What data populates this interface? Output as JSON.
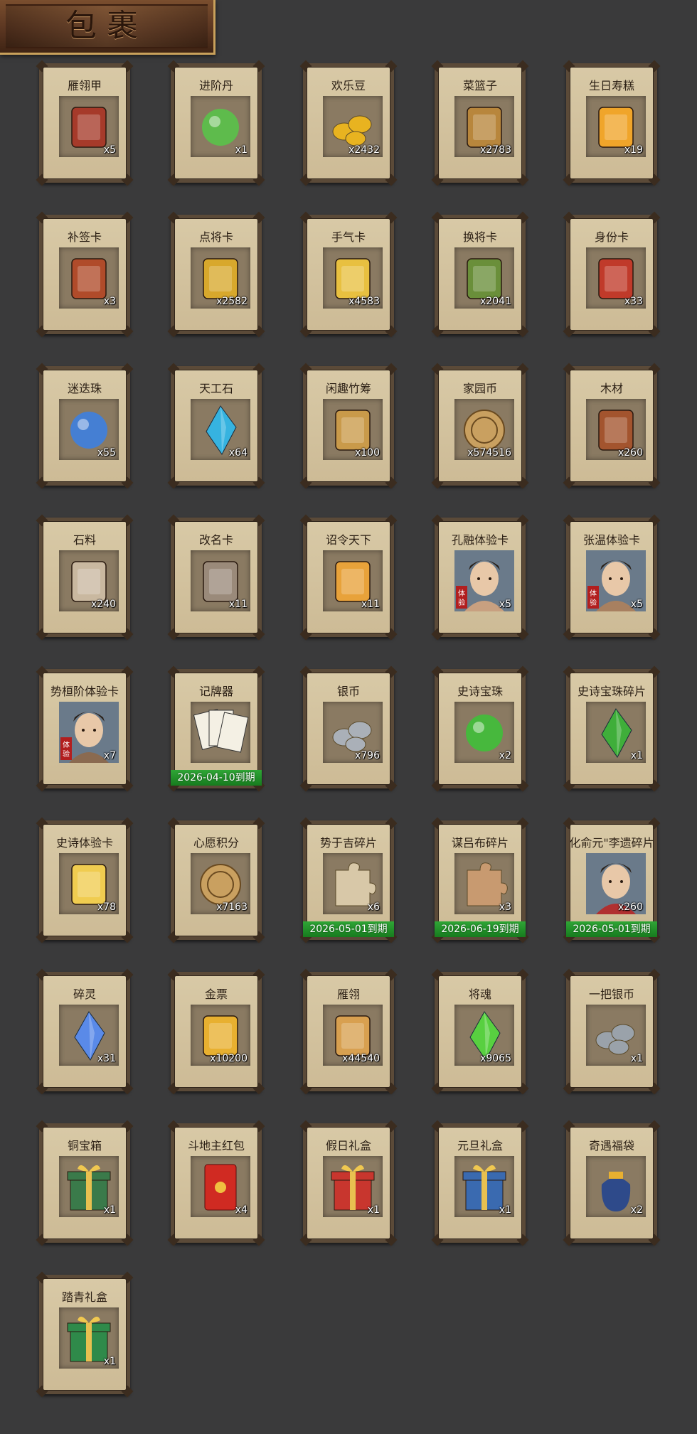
{
  "header": {
    "title": "包裹"
  },
  "colors": {
    "background": "#3a3a3b",
    "card_frame": "#5b4a38",
    "card_paper": "#d8c9a6",
    "expiry_green": "#1f9128"
  },
  "items": [
    {
      "name": "雁翎甲",
      "count": "x5",
      "icon": "armor-icon",
      "color": "#a63a2a"
    },
    {
      "name": "进阶丹",
      "count": "x1",
      "icon": "green-pill-icon",
      "color": "#59c24a"
    },
    {
      "name": "欢乐豆",
      "count": "x2432",
      "icon": "gold-beans-icon",
      "color": "#e8b320"
    },
    {
      "name": "菜篮子",
      "count": "x2783",
      "icon": "basket-icon",
      "color": "#b8863c"
    },
    {
      "name": "生日寿糕",
      "count": "x19",
      "icon": "cake-icon",
      "color": "#f0a52a"
    },
    {
      "name": "补签卡",
      "count": "x3",
      "icon": "token-card-icon",
      "color": "#b04b2a"
    },
    {
      "name": "点将卡",
      "count": "x2582",
      "icon": "general-card-icon",
      "color": "#d8a82c"
    },
    {
      "name": "手气卡",
      "count": "x4583",
      "icon": "luck-card-icon",
      "color": "#e8c040"
    },
    {
      "name": "换将卡",
      "count": "x2041",
      "icon": "swap-card-icon",
      "color": "#6a8f3a"
    },
    {
      "name": "身份卡",
      "count": "x33",
      "icon": "mask-card-icon",
      "color": "#c03a2a"
    },
    {
      "name": "迷迭珠",
      "count": "x55",
      "icon": "blue-orb-icon",
      "color": "#3d7fe0"
    },
    {
      "name": "天工石",
      "count": "x64",
      "icon": "crystal-icon",
      "color": "#36b3e0"
    },
    {
      "name": "闲趣竹筹",
      "count": "x100",
      "icon": "bamboo-tally-icon",
      "color": "#c99a4a"
    },
    {
      "name": "家园币",
      "count": "x574516",
      "icon": "home-coin-icon",
      "color": "#c9a060"
    },
    {
      "name": "木材",
      "count": "x260",
      "icon": "wood-icon",
      "color": "#a3542e"
    },
    {
      "name": "石料",
      "count": "x240",
      "icon": "stone-icon",
      "color": "#c9b8a0"
    },
    {
      "name": "改名卡",
      "count": "x11",
      "icon": "rename-card-icon",
      "color": "#9a8a7a"
    },
    {
      "name": "诏令天下",
      "count": "x11",
      "icon": "edict-scroll-icon",
      "color": "#e8a23a"
    },
    {
      "name": "孔融体验卡",
      "count": "x5",
      "icon": "hero-portrait-icon",
      "color": "#c8a080",
      "portrait": true,
      "tag": "体验"
    },
    {
      "name": "张温体验卡",
      "count": "x5",
      "icon": "hero-portrait-icon",
      "color": "#a88060",
      "portrait": true,
      "tag": "体验"
    },
    {
      "name": "势桓阶体验卡",
      "count": "x7",
      "icon": "hero-portrait-icon",
      "color": "#8a6a50",
      "portrait": true,
      "tag": "体验"
    },
    {
      "name": "记牌器",
      "count": "",
      "icon": "playing-cards-icon",
      "color": "#f0ece0",
      "expiry": "2026-04-10到期"
    },
    {
      "name": "银币",
      "count": "x796",
      "icon": "silver-coins-icon",
      "color": "#aab0b8"
    },
    {
      "name": "史诗宝珠",
      "count": "x2",
      "icon": "green-orb-icon",
      "color": "#3fbf3a"
    },
    {
      "name": "史诗宝珠碎片",
      "count": "x1",
      "icon": "green-shard-icon",
      "color": "#3fae3a"
    },
    {
      "name": "史诗体验卡",
      "count": "x78",
      "icon": "gold-card-icon",
      "color": "#f0cc50"
    },
    {
      "name": "心愿积分",
      "count": "x7163",
      "icon": "heart-coin-icon",
      "color": "#c9a060"
    },
    {
      "name": "势于吉碎片",
      "count": "x6",
      "icon": "puzzle-piece-icon",
      "color": "#d8c8a8",
      "expiry": "2026-05-01到期"
    },
    {
      "name": "谋吕布碎片",
      "count": "x3",
      "icon": "puzzle-piece-icon",
      "color": "#c89a70",
      "expiry": "2026-06-19到期"
    },
    {
      "name": "化俞元\"李遗碎片",
      "count": "x260",
      "icon": "hero-portrait-icon",
      "color": "#b03030",
      "portrait": true,
      "expiry": "2026-05-01到期"
    },
    {
      "name": "碎灵",
      "count": "x31",
      "icon": "blue-shard-icon",
      "color": "#5a8ae8"
    },
    {
      "name": "金票",
      "count": "x10200",
      "icon": "gold-ticket-icon",
      "color": "#e8b030"
    },
    {
      "name": "雁翎",
      "count": "x44540",
      "icon": "feather-icon",
      "color": "#d8a050"
    },
    {
      "name": "将魂",
      "count": "x9065",
      "icon": "green-soul-icon",
      "color": "#58d040"
    },
    {
      "name": "一把银币",
      "count": "x1",
      "icon": "silver-coins-icon",
      "color": "#9aa2aa"
    },
    {
      "name": "铜宝箱",
      "count": "x1",
      "icon": "treasure-chest-icon",
      "color": "#3a7a4a"
    },
    {
      "name": "斗地主红包",
      "count": "x4",
      "icon": "red-envelope-icon",
      "color": "#d02a22"
    },
    {
      "name": "假日礼盒",
      "count": "x1",
      "icon": "red-gift-icon",
      "color": "#c8362e"
    },
    {
      "name": "元旦礼盒",
      "count": "x1",
      "icon": "blue-gift-icon",
      "color": "#3a6ab0"
    },
    {
      "name": "奇遇福袋",
      "count": "x2",
      "icon": "lucky-bag-icon",
      "color": "#2e4a8a"
    },
    {
      "name": "踏青礼盒",
      "count": "x1",
      "icon": "green-gift-icon",
      "color": "#2f8a4a"
    }
  ]
}
